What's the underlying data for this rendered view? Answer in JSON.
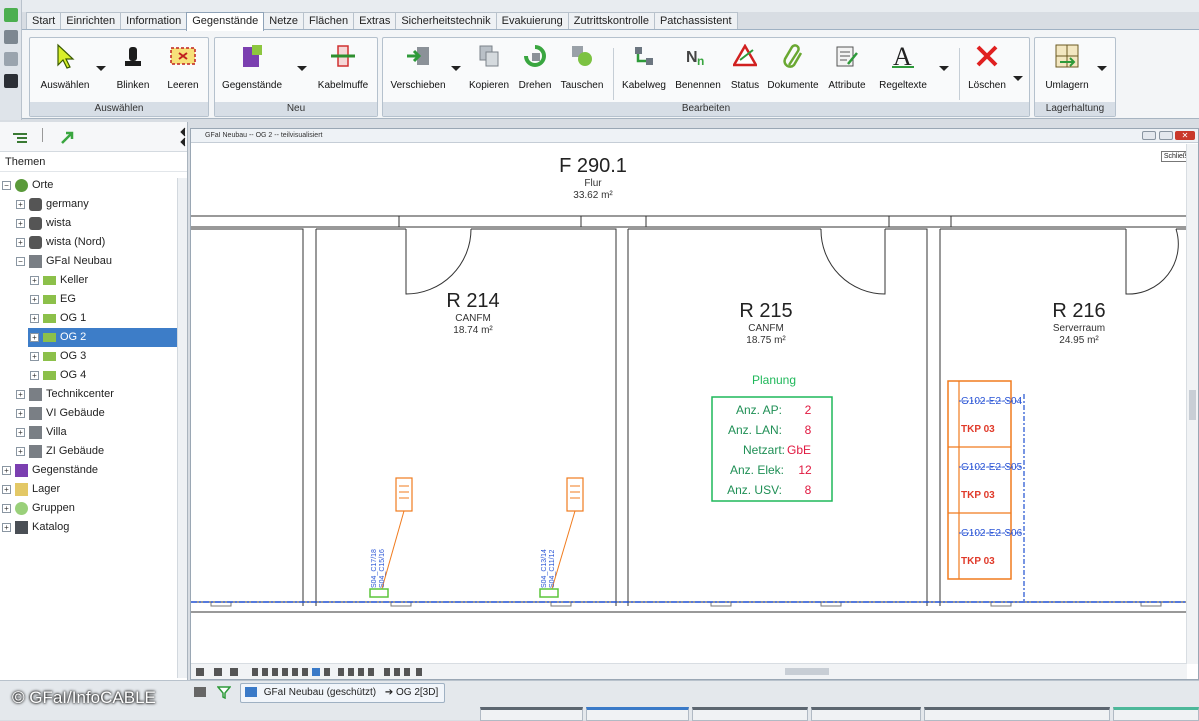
{
  "ribbon": {
    "tabs": [
      "Start",
      "Einrichten",
      "Information",
      "Gegenstände",
      "Netze",
      "Flächen",
      "Extras",
      "Sicherheitstechnik",
      "Evakuierung",
      "Zutrittskontrolle",
      "Patchassistent"
    ],
    "groups": {
      "auswaehlen": {
        "title": "Auswählen",
        "buttons": [
          "Auswählen",
          "Blinken",
          "Leeren"
        ]
      },
      "neu": {
        "title": "Neu",
        "buttons": [
          "Gegenstände",
          "Kabelmuffe"
        ]
      },
      "bearbeiten": {
        "title": "Bearbeiten",
        "buttons": [
          "Verschieben",
          "Kopieren",
          "Drehen",
          "Tauschen",
          "Kabelweg",
          "Benennen",
          "Status",
          "Dokumente",
          "Attribute",
          "Regeltexte",
          "Löschen"
        ]
      },
      "lager": {
        "title": "Lagerhaltung",
        "buttons": [
          "Umlagern"
        ]
      }
    }
  },
  "sidebar": {
    "title": "Themen",
    "tree": [
      "Orte",
      "germany",
      "wista",
      "wista (Nord)",
      "GFaI Neubau",
      "Keller",
      "EG",
      "OG 1",
      "OG 2",
      "OG 3",
      "OG 4",
      "Technikcenter",
      "VI Gebäude",
      "Villa",
      "ZI Gebäude",
      "Gegenstände",
      "Lager",
      "Gruppen",
      "Katalog"
    ]
  },
  "canvas": {
    "title": "GFaI Neubau -- OG 2 -- teilvisualisiert",
    "tooltip": "Schließen",
    "rooms": [
      {
        "id": "F 290.1",
        "type": "Flur",
        "area": "33.62 m²"
      },
      {
        "id": "R 214",
        "type": "CANFM",
        "area": "18.74 m²"
      },
      {
        "id": "R 215",
        "type": "CANFM",
        "area": "18.75 m²"
      },
      {
        "id": "R 216",
        "type": "Serverraum",
        "area": "24.95 m²"
      }
    ],
    "planning": {
      "title": "Planung",
      "rows": [
        {
          "label": "Anz. AP:",
          "value": "2"
        },
        {
          "label": "Anz. LAN:",
          "value": "8"
        },
        {
          "label": "Netzart:",
          "value": "GbE"
        },
        {
          "label": "Anz. Elek:",
          "value": "12"
        },
        {
          "label": "Anz. USV:",
          "value": "8"
        }
      ]
    },
    "racks": [
      {
        "ports": "G102-E2-S04",
        "name": "TKP 03"
      },
      {
        "ports": "G102-E2-S05",
        "name": "TKP 03"
      },
      {
        "ports": "G102-E2-S06",
        "name": "TKP 03"
      }
    ],
    "sockets": [
      {
        "label1": "S04_C17/18",
        "label2": "S04_C15/16"
      },
      {
        "label1": "S04_C13/14",
        "label2": "S04_C11/12"
      }
    ]
  },
  "status": {
    "breadcrumb": "GFaI Neubau (geschützt)",
    "target": "➔ OG 2[3D]"
  },
  "watermark": "© GFaI/InfoCABLE",
  "colors": {
    "room": "#222",
    "planning": "#1fb85a",
    "value": "#e0173f",
    "rack": "#f07b1e",
    "port": "#2a55d6",
    "cable": "#1f4fd0"
  }
}
